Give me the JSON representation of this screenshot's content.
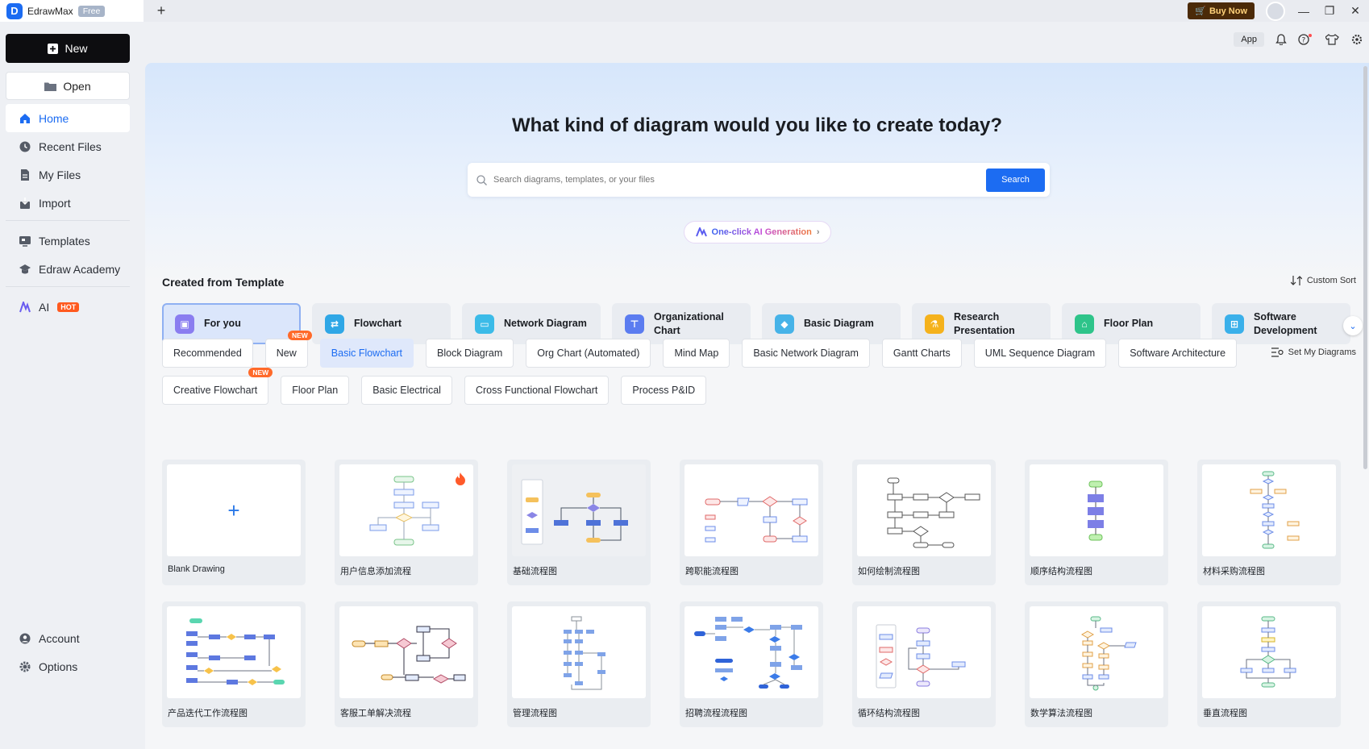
{
  "titlebar": {
    "app_name": "EdrawMax",
    "badge": "Free",
    "new_tab": "+",
    "buy_now": "Buy Now",
    "min": "—",
    "restore": "❐",
    "close": "✕"
  },
  "sidebar": {
    "new_label": "New",
    "open_label": "Open",
    "items": [
      {
        "label": "Home",
        "icon": "home-icon"
      },
      {
        "label": "Recent Files",
        "icon": "clock-icon"
      },
      {
        "label": "My Files",
        "icon": "file-icon"
      },
      {
        "label": "Import",
        "icon": "import-icon"
      },
      {
        "label": "Templates",
        "icon": "templates-icon"
      },
      {
        "label": "Edraw Academy",
        "icon": "academy-icon"
      },
      {
        "label": "AI",
        "icon": "ai-icon"
      },
      {
        "label": "Account",
        "icon": "account-icon"
      },
      {
        "label": "Options",
        "icon": "gear-icon"
      }
    ],
    "hot_badge": "HOT"
  },
  "topbar": {
    "app": "App"
  },
  "hero": {
    "title": "What kind of diagram would you like to create today?",
    "search_placeholder": "Search diagrams, templates, or your files",
    "search_button": "Search",
    "ai_generation": "One-click AI Generation"
  },
  "templates": {
    "section_title": "Created from Template",
    "custom_sort": "Custom Sort",
    "set_my_diagrams": "Set My Diagrams",
    "categories": [
      {
        "label": "For you",
        "color": "#8a7df0"
      },
      {
        "label": "Flowchart",
        "color": "#2fa7e6"
      },
      {
        "label": "Network Diagram",
        "color": "#3bbbe8"
      },
      {
        "label": "Organizational Chart",
        "color": "#5b7cf0"
      },
      {
        "label": "Basic Diagram",
        "color": "#46b3e8"
      },
      {
        "label": "Research Presentation",
        "color": "#f5b21c"
      },
      {
        "label": "Floor Plan",
        "color": "#2ec48a"
      },
      {
        "label": "Software Development",
        "color": "#3ab0ea"
      }
    ],
    "chips_row1": [
      "Recommended",
      "New",
      "Basic Flowchart",
      "Block Diagram",
      "Org Chart (Automated)",
      "Mind Map",
      "Basic Network Diagram",
      "Gantt Charts",
      "UML Sequence Diagram",
      "Software Architecture"
    ],
    "chips_row2": [
      "Creative Flowchart",
      "Floor Plan",
      "Basic Electrical",
      "Cross Functional Flowchart",
      "Process P&ID"
    ],
    "new_badge": "NEW",
    "cards": [
      "Blank Drawing",
      "用户信息添加流程",
      "基础流程图",
      "跨职能流程图",
      "如何绘制流程图",
      "顺序结构流程图",
      "材料采购流程图",
      "产品迭代工作流程图",
      "客服工单解决流程",
      "管理流程图",
      "招聘流程流程图",
      "循环结构流程图",
      "数学算法流程图",
      "垂直流程图"
    ]
  },
  "colors": {
    "accent": "#1c6cf2",
    "sidebar_bg": "#eef0f4",
    "hot": "#ff5a1f"
  }
}
